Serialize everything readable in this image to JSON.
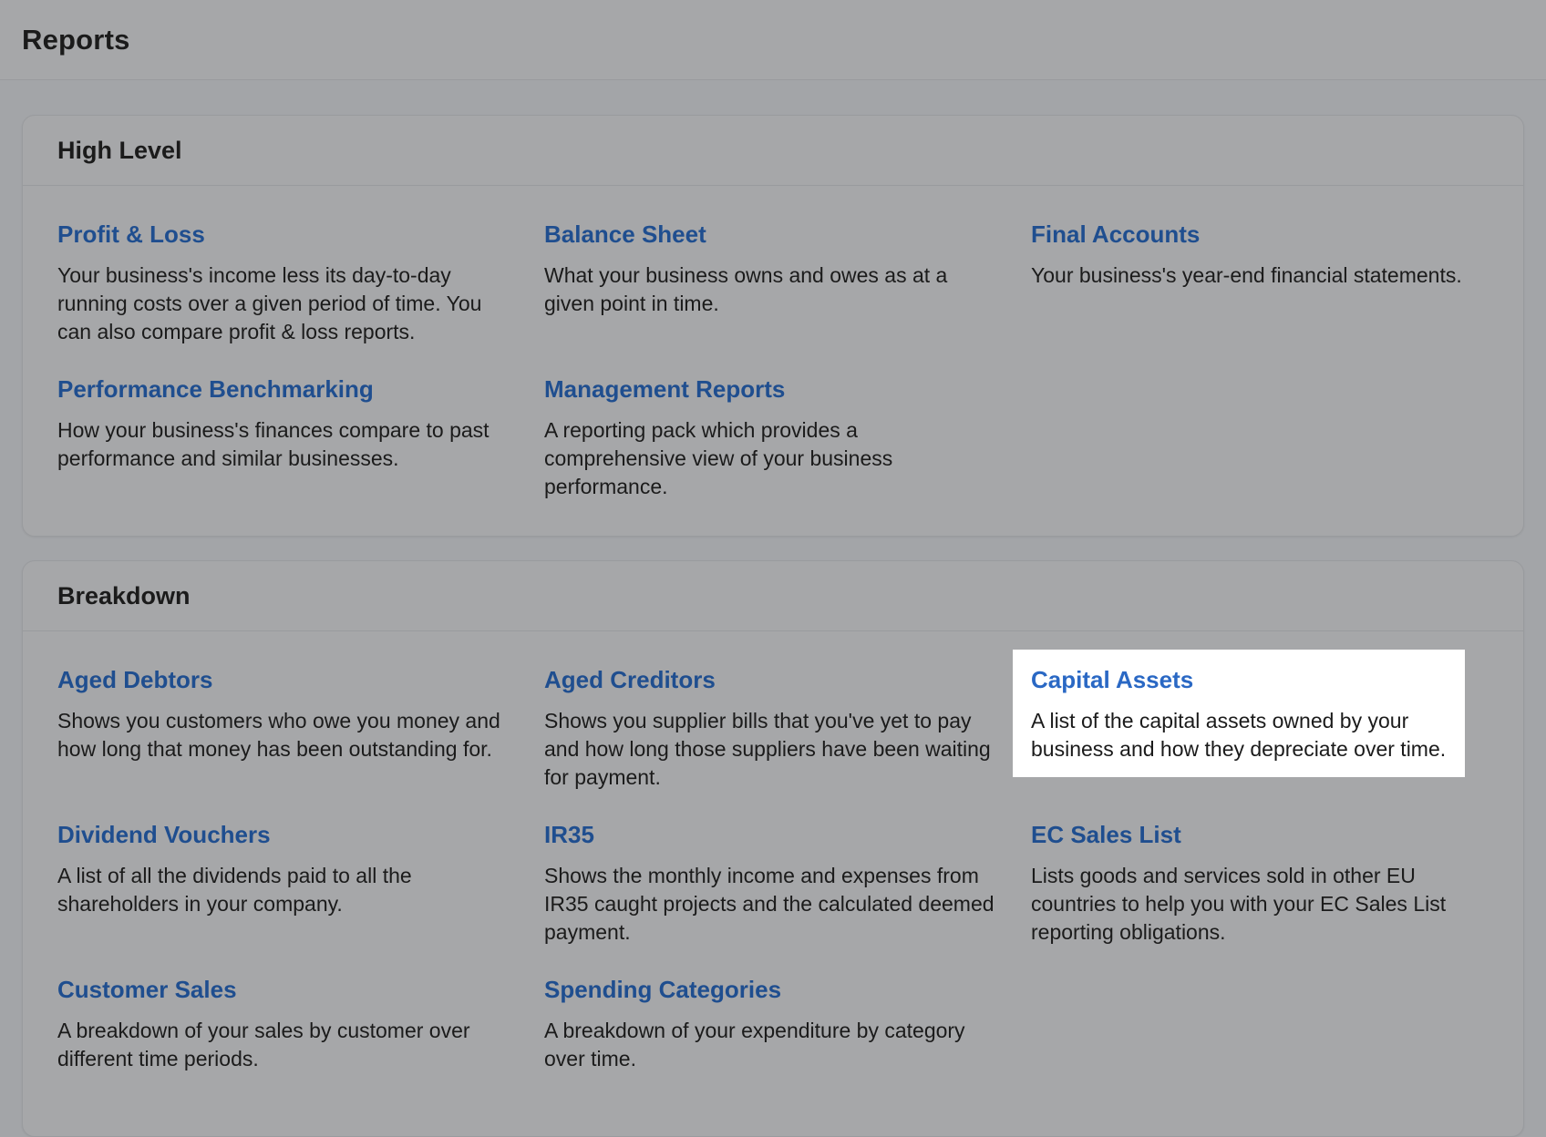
{
  "header": {
    "title": "Reports"
  },
  "sections": [
    {
      "title": "High Level",
      "items": [
        {
          "label": "Profit & Loss",
          "description": "Your business's income less its day-to-day running costs over a given period of time. You can also compare profit & loss reports."
        },
        {
          "label": "Balance Sheet",
          "description": "What your business owns and owes as at a given point in time."
        },
        {
          "label": "Final Accounts",
          "description": "Your business's year-end financial statements."
        },
        {
          "label": "Performance Benchmarking",
          "description": "How your business's finances compare to past performance and similar businesses."
        },
        {
          "label": "Management Reports",
          "description": "A reporting pack which provides a comprehensive view of your business performance."
        }
      ]
    },
    {
      "title": "Breakdown",
      "items": [
        {
          "label": "Aged Debtors",
          "description": "Shows you customers who owe you money and how long that money has been outstanding for."
        },
        {
          "label": "Aged Creditors",
          "description": "Shows you supplier bills that you've yet to pay and how long those suppliers have been waiting for payment."
        },
        {
          "label": "Capital Assets",
          "description": "A list of the capital assets owned by your business and how they depreciate over time.",
          "highlighted": true
        },
        {
          "label": "Dividend Vouchers",
          "description": "A list of all the dividends paid to all the shareholders in your company."
        },
        {
          "label": "IR35",
          "description": "Shows the monthly income and expenses from IR35 caught projects and the calculated deemed payment."
        },
        {
          "label": "EC Sales List",
          "description": "Lists goods and services sold in other EU countries to help you with your EC Sales List reporting obligations."
        },
        {
          "label": "Customer Sales",
          "description": "A breakdown of your sales by customer over different time periods."
        },
        {
          "label": "Spending Categories",
          "description": "A breakdown of your expenditure by category over time."
        }
      ]
    }
  ],
  "colors": {
    "link": "#1f4e8f",
    "link_highlighted": "#2a68c4",
    "background": "#a3a5a8",
    "highlight_background": "#ffffff"
  }
}
